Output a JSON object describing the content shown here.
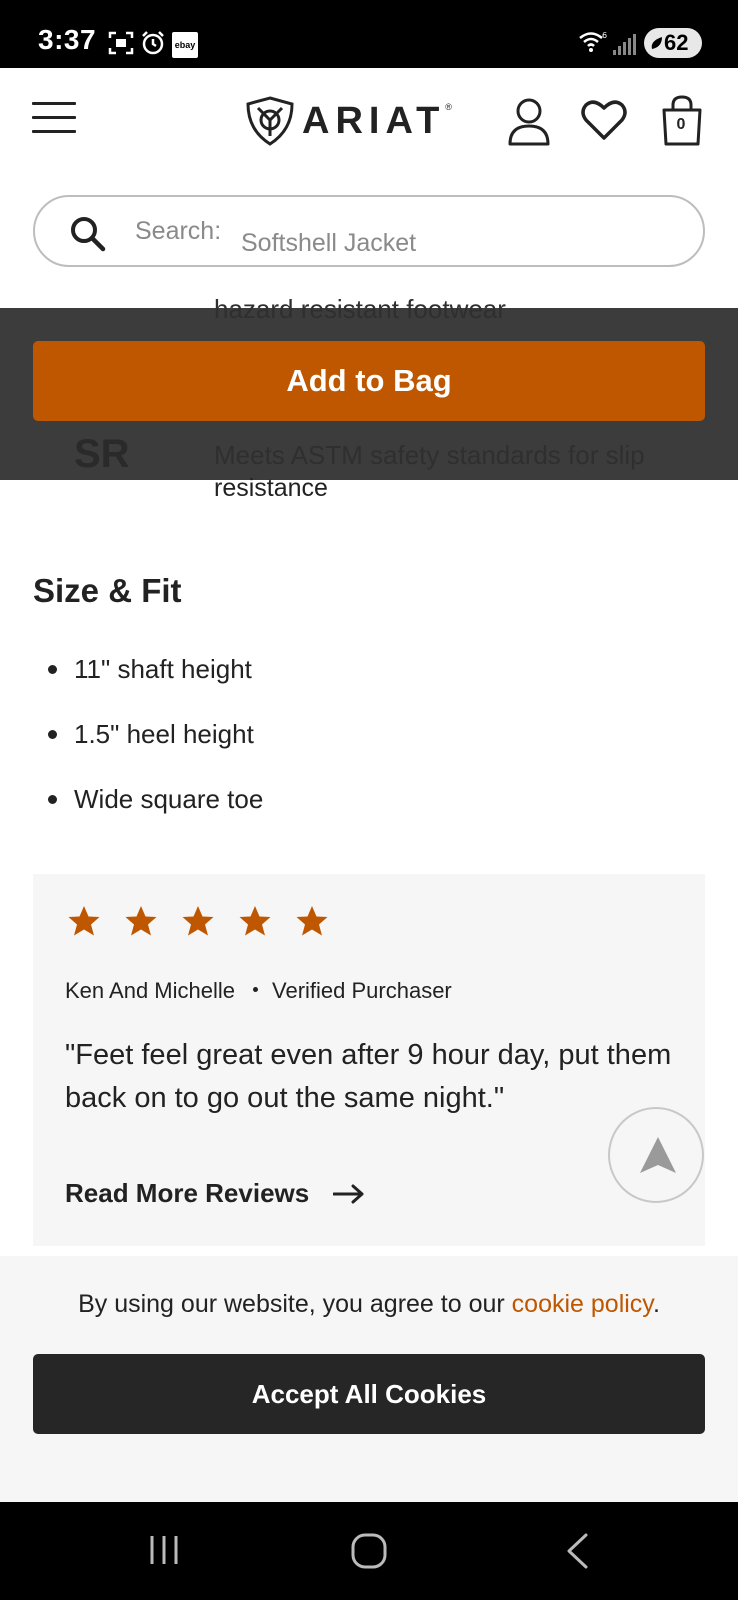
{
  "status_bar": {
    "time": "3:37",
    "ebay_label": "ebay",
    "battery": "62",
    "icons": [
      "screenshot-icon",
      "alarm-icon",
      "ebay-icon",
      "wifi-icon",
      "signal-icon",
      "battery-icon"
    ]
  },
  "header": {
    "logo_text": "ARIAT",
    "logo_mark": "®",
    "bag_count": "0",
    "icons": [
      "menu-icon",
      "ariat-shield-icon",
      "account-icon",
      "heart-icon",
      "bag-icon"
    ]
  },
  "search": {
    "label": "Search:",
    "value": "Softshell Jacket"
  },
  "sticky": {
    "add_to_bag": "Add to Bag",
    "behind_top": "hazard resistant footwear",
    "behind_badge": "SR",
    "behind_line1": "Meets ASTM safety standards for slip"
  },
  "feature": {
    "line2": "resistance"
  },
  "size_fit": {
    "title": "Size & Fit",
    "items": [
      "11\" shaft height",
      "1.5\" heel height",
      "Wide square toe"
    ]
  },
  "review": {
    "rating": 5,
    "rating_max": 5,
    "reviewer": "Ken And Michelle",
    "badge": "Verified Purchaser",
    "quote": "\"Feet feel great even after 9 hour day, put them back on to go out the same night.\"",
    "read_more": "Read More Reviews"
  },
  "cookie": {
    "text_before": "By using our website, you agree to our ",
    "link": "cookie policy",
    "text_after": ".",
    "accept": "Accept All Cookies"
  },
  "colors": {
    "brand_orange": "#bf5700",
    "dark_button": "#262626",
    "overlay": "#3c3c3c",
    "card_bg": "#f6f6f6"
  }
}
